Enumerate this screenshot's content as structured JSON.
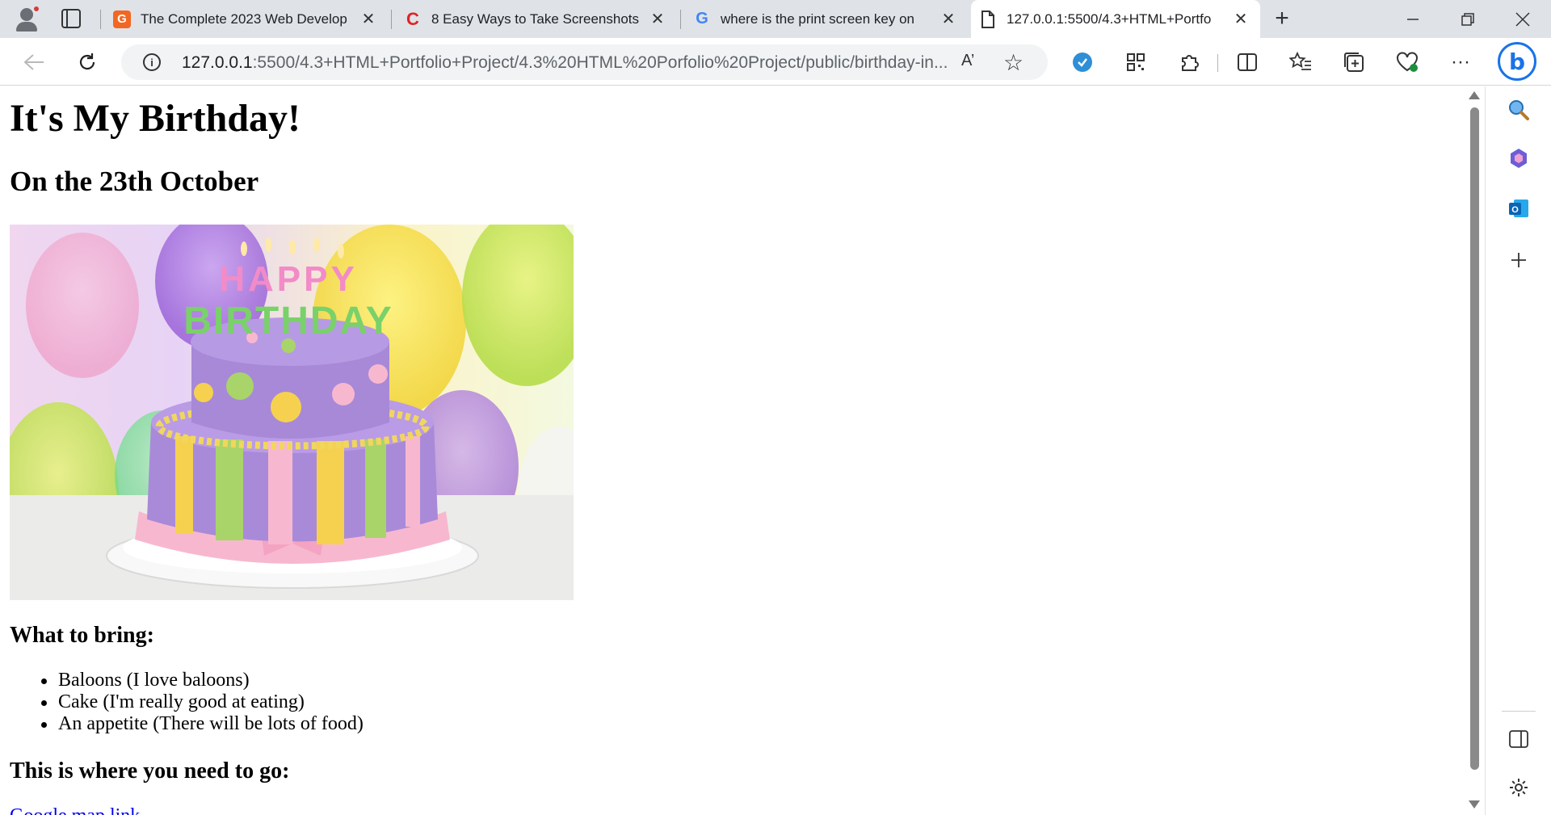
{
  "browser": {
    "tabs": [
      {
        "title": "The Complete 2023 Web Develop",
        "favicon": "G",
        "favicon_color": "#f26722",
        "active": false
      },
      {
        "title": "8 Easy Ways to Take Screenshots",
        "favicon": "C",
        "favicon_color": "#e02424",
        "active": false
      },
      {
        "title": "where is the print screen key on",
        "favicon": "G",
        "favicon_color": "#4285f4",
        "active": false
      },
      {
        "title": "127.0.0.1:5500/4.3+HTML+Portfo",
        "favicon": "page-icon",
        "favicon_color": "#333333",
        "active": true
      }
    ],
    "new_tab_label": "+",
    "url_host": "127.0.0.1",
    "url_rest": ":5500/4.3+HTML+Portfolio+Project/4.3%20HTML%20Porfolio%20Project/public/birthday-in...",
    "read_aloud_label": "A’"
  },
  "page": {
    "heading": "It's My Birthday!",
    "subheading": "On the 23th October",
    "image_text": "HAPPY BIRTHDAY",
    "bring_heading": "What to bring:",
    "bring_items": [
      "Baloons (I love baloons)",
      "Cake (I'm really good at eating)",
      "An appetite (There will be lots of food)"
    ],
    "where_heading": "This is where you need to go:",
    "map_link_text": "Google map link"
  }
}
